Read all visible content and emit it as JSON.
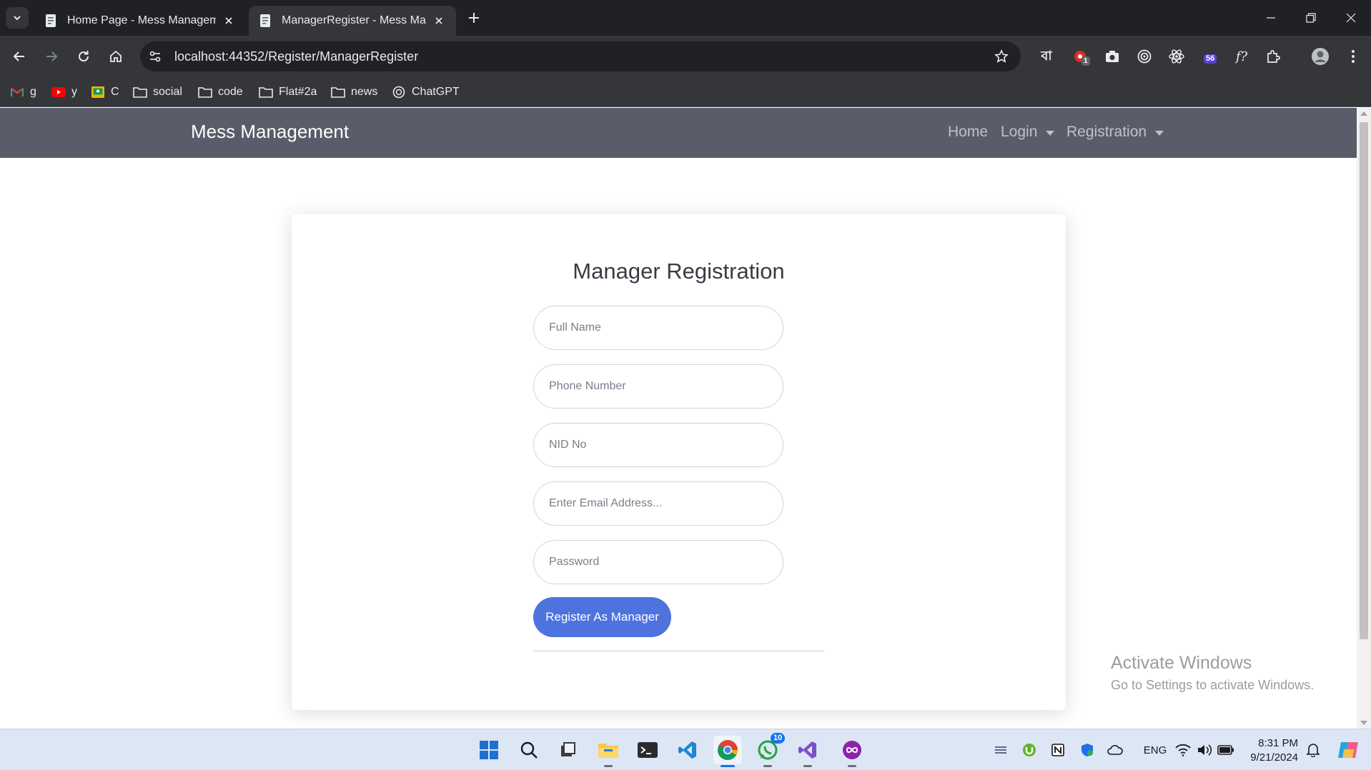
{
  "browser": {
    "tabs": [
      {
        "title": "Home Page - Mess Managemen",
        "active": false
      },
      {
        "title": "ManagerRegister - Mess Manag",
        "active": true
      }
    ],
    "url": "localhost:44352/Register/ManagerRegister",
    "bookmarks": [
      {
        "label": "g",
        "icon": "gmail-icon"
      },
      {
        "label": "y",
        "icon": "youtube-icon"
      },
      {
        "label": "C",
        "icon": "classroom-icon"
      },
      {
        "label": "social",
        "icon": "folder-icon"
      },
      {
        "label": "code",
        "icon": "folder-icon"
      },
      {
        "label": "Flat#2a",
        "icon": "folder-icon"
      },
      {
        "label": "news",
        "icon": "folder-icon"
      },
      {
        "label": "ChatGPT",
        "icon": "chatgpt-icon"
      }
    ],
    "extensions": {
      "bangla_label": "বা",
      "badge_one": "1",
      "badge_fiftysix": "56",
      "fx_label": "f?"
    }
  },
  "site": {
    "brand": "Mess Management",
    "nav": {
      "home": "Home",
      "login": "Login",
      "registration": "Registration"
    }
  },
  "form": {
    "title": "Manager Registration",
    "fields": {
      "full_name": {
        "placeholder": "Full Name",
        "value": ""
      },
      "phone": {
        "placeholder": "Phone Number",
        "value": ""
      },
      "nid": {
        "placeholder": "NID No",
        "value": ""
      },
      "email": {
        "placeholder": "Enter Email Address...",
        "value": ""
      },
      "password": {
        "placeholder": "Password",
        "value": ""
      }
    },
    "submit_label": "Register As Manager"
  },
  "watermark": {
    "line1": "Activate Windows",
    "line2": "Go to Settings to activate Windows."
  },
  "taskbar": {
    "whatsapp_badge": "10",
    "language": "ENG",
    "time": "8:31 PM",
    "date": "9/21/2024"
  },
  "colors": {
    "navbar": "#5a5c69",
    "primary_button": "#4e73df",
    "chrome_dark": "#202124",
    "chrome_toolbar": "#35363a"
  }
}
